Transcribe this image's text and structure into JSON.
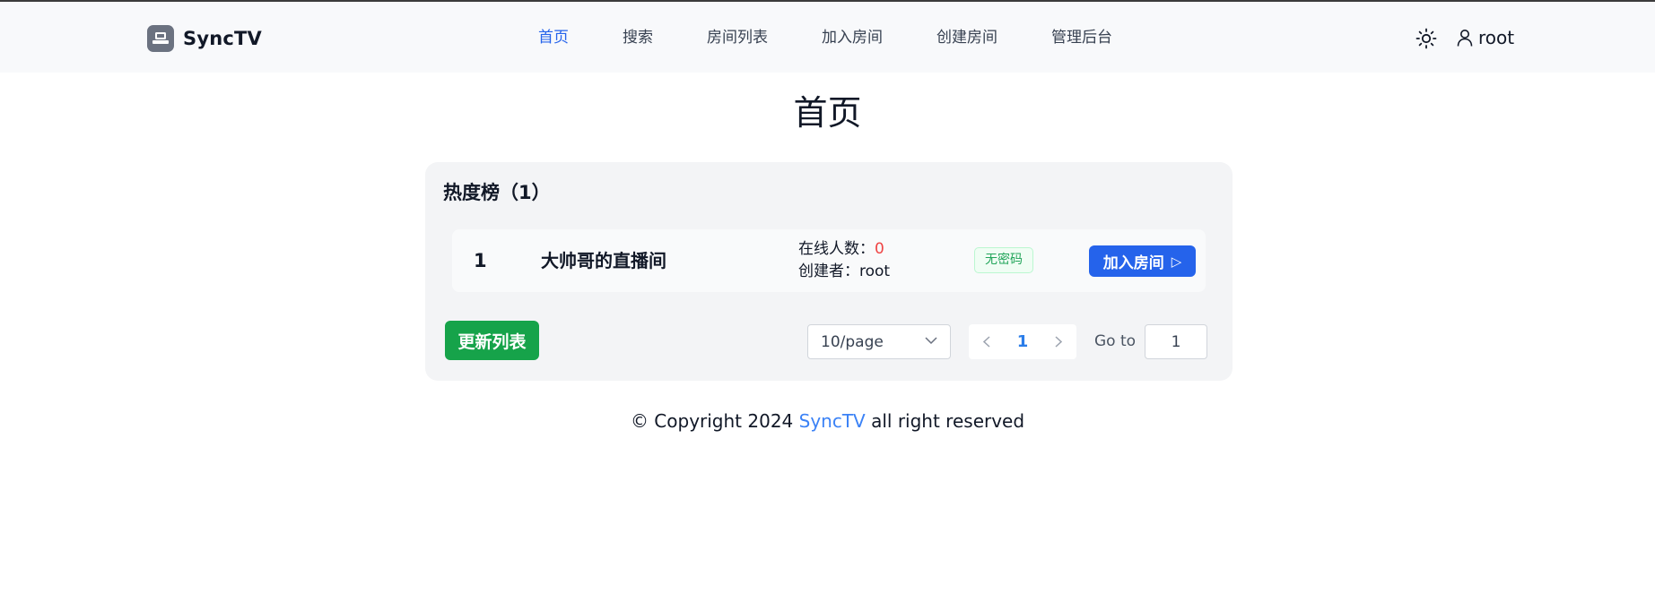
{
  "header": {
    "brand": "SyncTV",
    "nav": [
      {
        "label": "首页",
        "active": true
      },
      {
        "label": "搜索"
      },
      {
        "label": "房间列表"
      },
      {
        "label": "加入房间"
      },
      {
        "label": "创建房间"
      },
      {
        "label": "管理后台"
      }
    ],
    "user": "root",
    "icons": {
      "theme": "sun-icon",
      "user": "user-icon",
      "logo": "tv-logo-icon"
    }
  },
  "main": {
    "title": "首页",
    "hot": {
      "title": "热度榜（1）",
      "rooms": [
        {
          "rank": "1",
          "name": "大帅哥的直播间",
          "online_label": "在线人数：",
          "online_count": "0",
          "creator_label": "创建者：",
          "creator": "root",
          "badge": "无密码",
          "join_label": "加入房间"
        }
      ]
    },
    "refresh_label": "更新列表",
    "pagination": {
      "page_size": "10/page",
      "current_page": "1",
      "goto_label": "Go to",
      "goto_value": "1"
    }
  },
  "footer": {
    "prefix": "© Copyright 2024",
    "link": "SyncTV",
    "suffix": "all right reserved"
  },
  "colors": {
    "accent": "#2563eb",
    "success": "#16a34a",
    "danger": "#ef4444"
  }
}
